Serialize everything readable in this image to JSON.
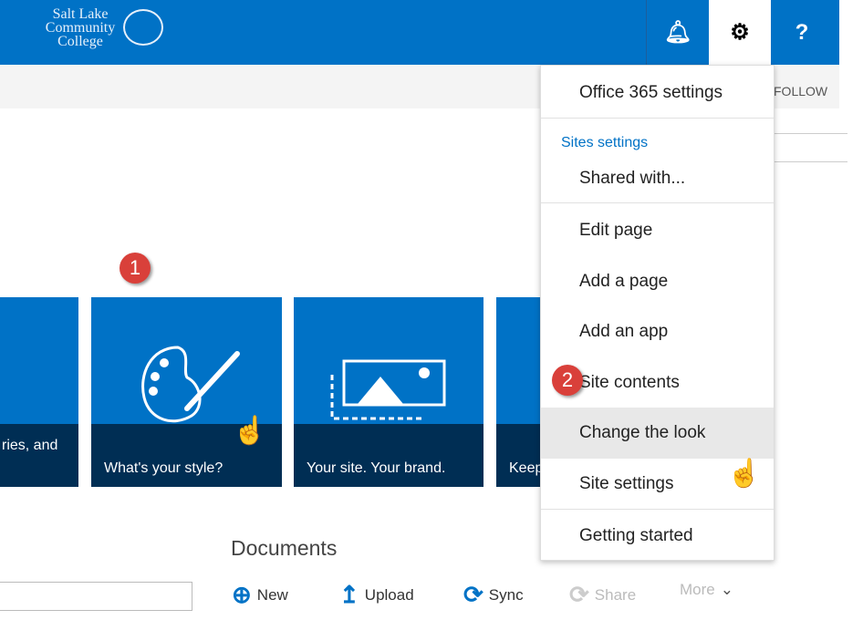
{
  "header": {
    "logo_lines": [
      "Salt Lake",
      "Community",
      "College"
    ],
    "bell_icon": "bell-icon",
    "gear_icon": "gear-icon",
    "help_label": "?",
    "follow_label": "FOLLOW"
  },
  "tiles": [
    {
      "caption": "ries, and"
    },
    {
      "caption": "What's your style?"
    },
    {
      "caption": "Your site. Your brand."
    },
    {
      "caption": "Keep"
    }
  ],
  "callouts": [
    "1",
    "2"
  ],
  "documents": {
    "title": "Documents",
    "commands": [
      {
        "label": "New",
        "icon": "⊕"
      },
      {
        "label": "Upload",
        "icon": "↥"
      },
      {
        "label": "Sync",
        "icon": "⟳"
      },
      {
        "label": "Share",
        "icon": "⟳"
      },
      {
        "label": "More",
        "icon": "⌄"
      }
    ]
  },
  "menu": {
    "office365": "Office 365 settings",
    "section": "Sites settings",
    "items": [
      "Shared with...",
      "Edit page",
      "Add a page",
      "Add an app",
      "Site contents",
      "Change the look",
      "Site settings",
      "Getting started"
    ],
    "highlighted": "Change the look"
  },
  "colors": {
    "brand": "#0072c6",
    "caption": "#002e54",
    "callout": "#d9403a"
  }
}
